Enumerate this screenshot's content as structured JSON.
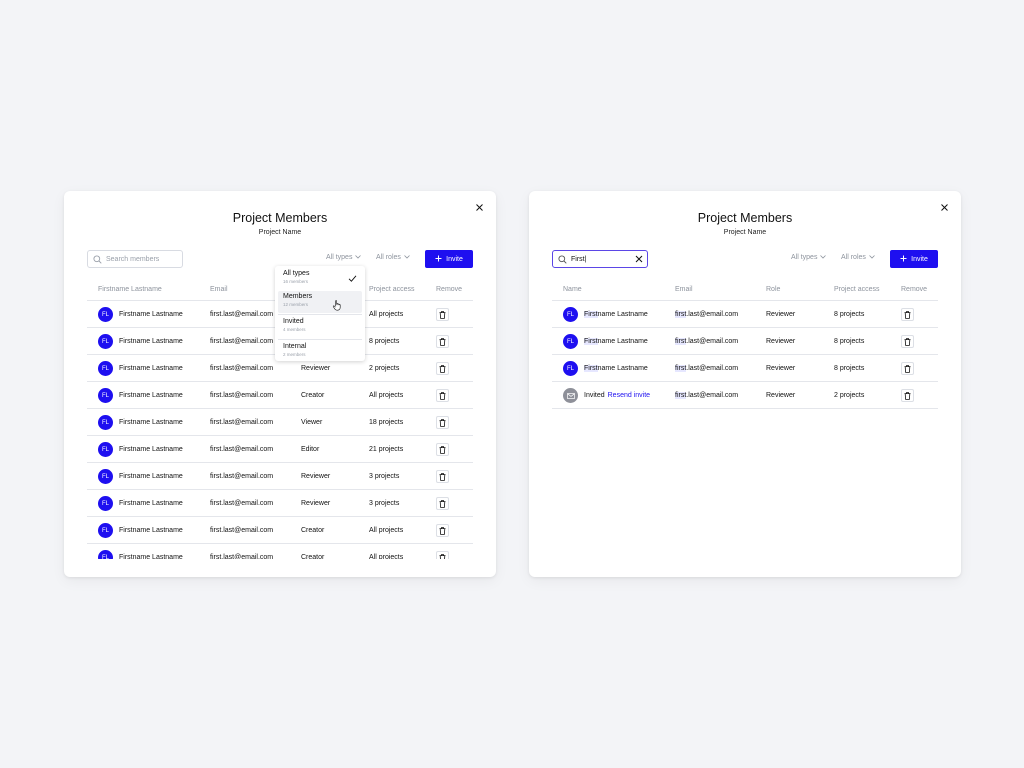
{
  "left": {
    "title": "Project Members",
    "subtitle": "Project Name",
    "search_placeholder": "Search members",
    "filter_types": "All types",
    "filter_roles": "All roles",
    "invite_label": "Invite",
    "columns": [
      "Firstname Lastname",
      "Email",
      "Project access",
      "Remove"
    ],
    "rows": [
      {
        "initials": "FL",
        "name": "Firstname Lastname",
        "email": "first.last@email.com",
        "role": "",
        "access": "All projects"
      },
      {
        "initials": "FL",
        "name": "Firstname Lastname",
        "email": "first.last@email.com",
        "role": "",
        "access": "8 projects"
      },
      {
        "initials": "FL",
        "name": "Firstname Lastname",
        "email": "first.last@email.com",
        "role": "Reviewer",
        "access": "2 projects"
      },
      {
        "initials": "FL",
        "name": "Firstname Lastname",
        "email": "first.last@email.com",
        "role": "Creator",
        "access": "All projects"
      },
      {
        "initials": "FL",
        "name": "Firstname Lastname",
        "email": "first.last@email.com",
        "role": "Viewer",
        "access": "18 projects"
      },
      {
        "initials": "FL",
        "name": "Firstname Lastname",
        "email": "first.last@email.com",
        "role": "Editor",
        "access": "21 projects"
      },
      {
        "initials": "FL",
        "name": "Firstname Lastname",
        "email": "first.last@email.com",
        "role": "Reviewer",
        "access": "3 projects"
      },
      {
        "initials": "FL",
        "name": "Firstname Lastname",
        "email": "first.last@email.com",
        "role": "Reviewer",
        "access": "3 projects"
      },
      {
        "initials": "FL",
        "name": "Firstname Lastname",
        "email": "first.last@email.com",
        "role": "Creator",
        "access": "All projects"
      },
      {
        "initials": "FL",
        "name": "Firstname Lastname",
        "email": "first.last@email.com",
        "role": "Creator",
        "access": "All projects"
      }
    ],
    "dropdown": [
      {
        "label": "All types",
        "count": "16 members",
        "selected": true
      },
      {
        "label": "Members",
        "count": "12 members",
        "hover": true
      },
      {
        "label": "Invited",
        "count": "4 members"
      },
      {
        "label": "Internal",
        "count": "2 members"
      }
    ]
  },
  "right": {
    "title": "Project Members",
    "subtitle": "Project Name",
    "search_value": "First|",
    "filter_types": "All types",
    "filter_roles": "All roles",
    "invite_label": "Invite",
    "columns": [
      "Name",
      "Email",
      "Role",
      "Project access",
      "Remove"
    ],
    "match_prefix": "First",
    "match_prefix_email": "first",
    "rows": [
      {
        "initials": "FL",
        "name_rest": "name Lastname",
        "email_rest": ".last@email.com",
        "role": "Reviewer",
        "access": "8 projects"
      },
      {
        "initials": "FL",
        "name_rest": "name Lastname",
        "email_rest": ".last@email.com",
        "role": "Reviewer",
        "access": "8 projects"
      },
      {
        "initials": "FL",
        "name_rest": "name Lastname",
        "email_rest": ".last@email.com",
        "role": "Reviewer",
        "access": "8 projects"
      }
    ],
    "invited_row": {
      "status": "Invited",
      "action": "Resend invite",
      "email_rest": ".last@email.com",
      "role": "Reviewer",
      "access": "2 projects"
    }
  },
  "colors": {
    "accent": "#1e0ff0",
    "highlight": "#e6e7ff",
    "border": "#e4e6eb"
  }
}
